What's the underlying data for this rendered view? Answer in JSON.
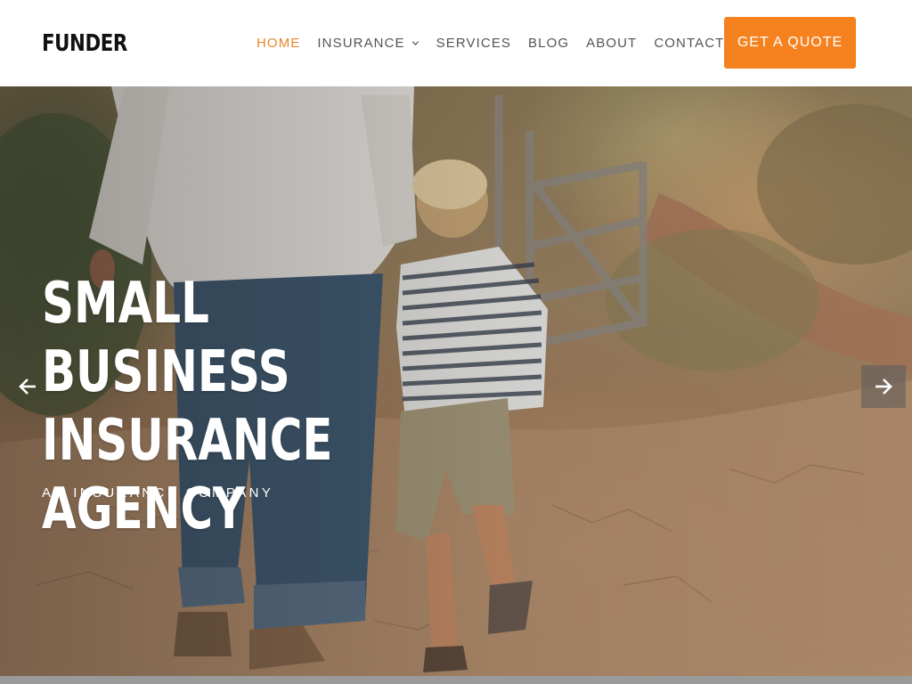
{
  "brand": {
    "logo_text": "FUNDER"
  },
  "nav": {
    "items": [
      {
        "label": "HOME",
        "active": true
      },
      {
        "label": "INSURANCE",
        "has_dropdown": true
      },
      {
        "label": "SERVICES"
      },
      {
        "label": "BLOG"
      },
      {
        "label": "ABOUT"
      },
      {
        "label": "CONTACT"
      }
    ],
    "cta_label": "GET A QUOTE"
  },
  "hero": {
    "title_lines": [
      "SMALL BUSINESS",
      "INSURANCE",
      "AGENCY"
    ],
    "subtitle": "AN INSURANCE COMPANY"
  },
  "icons": {
    "prev": "arrow-left-icon",
    "next": "arrow-right-icon",
    "dropdown": "chevron-down-icon"
  },
  "colors": {
    "accent": "#f5821f",
    "active_nav": "#e8862a",
    "nav_text": "#555555",
    "logo": "#111111"
  }
}
